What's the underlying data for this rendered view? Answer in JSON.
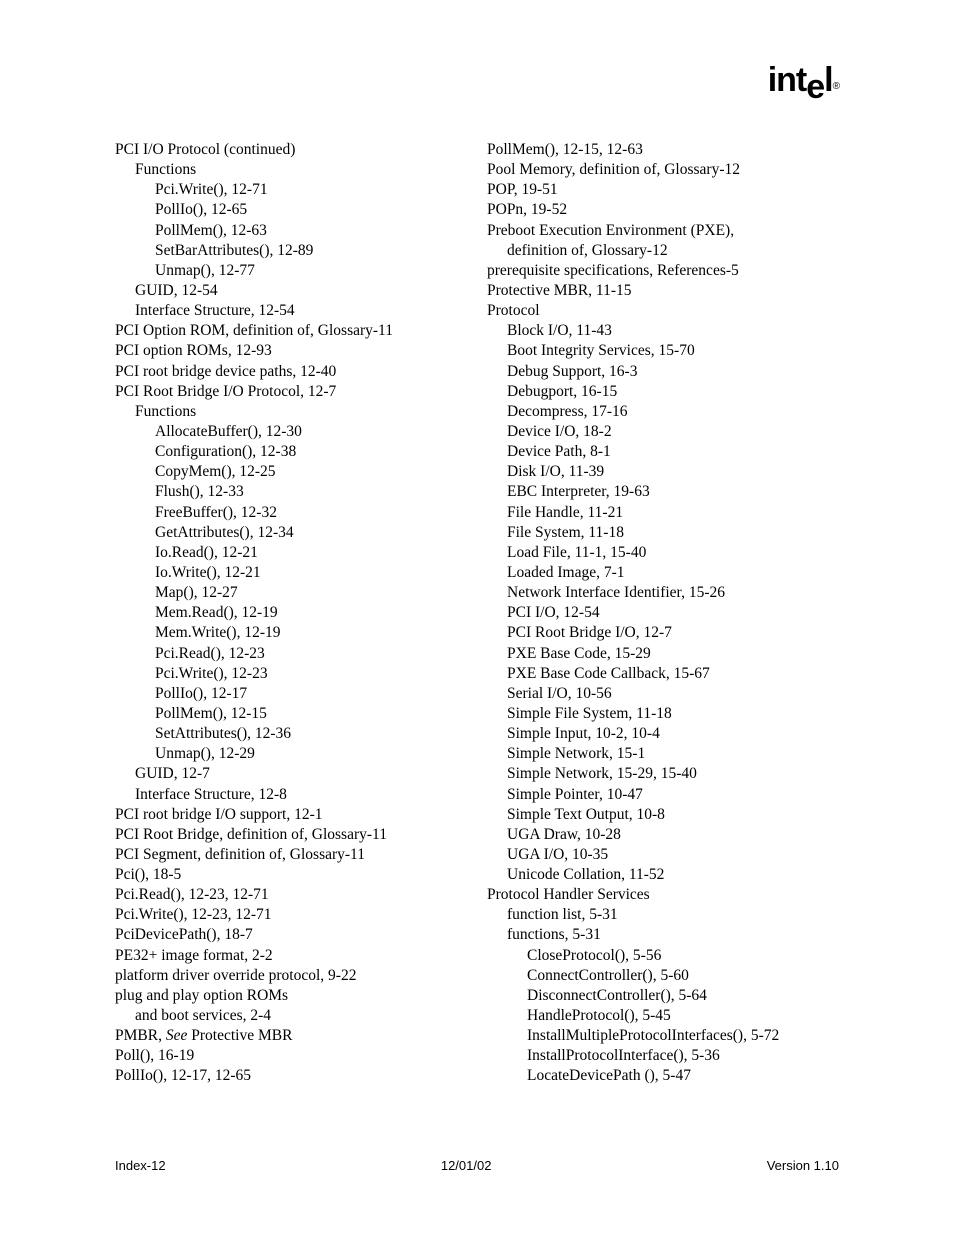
{
  "logo_text": "intel",
  "footer": {
    "left": "Index-12",
    "center": "12/01/02",
    "right": "Version 1.10"
  },
  "left_column": [
    {
      "text": "PCI I/O Protocol (continued)",
      "level": 0
    },
    {
      "text": "Functions",
      "level": 1
    },
    {
      "text": "Pci.Write(), 12-71",
      "level": 2
    },
    {
      "text": "PollIo(), 12-65",
      "level": 2
    },
    {
      "text": "PollMem(), 12-63",
      "level": 2
    },
    {
      "text": "SetBarAttributes(), 12-89",
      "level": 2
    },
    {
      "text": "Unmap(), 12-77",
      "level": 2
    },
    {
      "text": "GUID, 12-54",
      "level": 1
    },
    {
      "text": "Interface Structure, 12-54",
      "level": 1
    },
    {
      "text": "PCI Option ROM, definition of, Glossary-11",
      "level": 0
    },
    {
      "text": "PCI option ROMs, 12-93",
      "level": 0
    },
    {
      "text": "PCI root bridge device paths, 12-40",
      "level": 0
    },
    {
      "text": "PCI Root Bridge I/O Protocol, 12-7",
      "level": 0
    },
    {
      "text": "Functions",
      "level": 1
    },
    {
      "text": "AllocateBuffer(), 12-30",
      "level": 2
    },
    {
      "text": "Configuration(), 12-38",
      "level": 2
    },
    {
      "text": "CopyMem(), 12-25",
      "level": 2
    },
    {
      "text": "Flush(), 12-33",
      "level": 2
    },
    {
      "text": "FreeBuffer(), 12-32",
      "level": 2
    },
    {
      "text": "GetAttributes(), 12-34",
      "level": 2
    },
    {
      "text": "Io.Read(), 12-21",
      "level": 2
    },
    {
      "text": "Io.Write(), 12-21",
      "level": 2
    },
    {
      "text": "Map(), 12-27",
      "level": 2
    },
    {
      "text": "Mem.Read(), 12-19",
      "level": 2
    },
    {
      "text": "Mem.Write(), 12-19",
      "level": 2
    },
    {
      "text": "Pci.Read(), 12-23",
      "level": 2
    },
    {
      "text": "Pci.Write(), 12-23",
      "level": 2
    },
    {
      "text": "PollIo(), 12-17",
      "level": 2
    },
    {
      "text": "PollMem(), 12-15",
      "level": 2
    },
    {
      "text": "SetAttributes(), 12-36",
      "level": 2
    },
    {
      "text": "Unmap(), 12-29",
      "level": 2
    },
    {
      "text": "GUID, 12-7",
      "level": 1
    },
    {
      "text": "Interface Structure, 12-8",
      "level": 1
    },
    {
      "text": "PCI root bridge I/O support, 12-1",
      "level": 0
    },
    {
      "text": "PCI Root Bridge, definition of, Glossary-11",
      "level": 0
    },
    {
      "text": "PCI Segment, definition of, Glossary-11",
      "level": 0
    },
    {
      "text": "Pci(), 18-5",
      "level": 0
    },
    {
      "text": "Pci.Read(), 12-23, 12-71",
      "level": 0
    },
    {
      "text": "Pci.Write(), 12-23, 12-71",
      "level": 0
    },
    {
      "text": "PciDevicePath(), 18-7",
      "level": 0
    },
    {
      "text": "PE32+ image format, 2-2",
      "level": 0
    },
    {
      "text": "platform driver override protocol, 9-22",
      "level": 0
    },
    {
      "text": "plug and play option ROMs",
      "level": 0
    },
    {
      "text": "and boot services, 2-4",
      "level": 1
    },
    {
      "text": "PMBR, |See| Protective MBR",
      "level": 0,
      "hasItalic": true
    },
    {
      "text": "Poll(), 16-19",
      "level": 0
    },
    {
      "text": "PollIo(), 12-17, 12-65",
      "level": 0
    }
  ],
  "right_column": [
    {
      "text": "PollMem(), 12-15, 12-63",
      "level": 0
    },
    {
      "text": "Pool Memory, definition of, Glossary-12",
      "level": 0
    },
    {
      "text": "POP, 19-51",
      "level": 0
    },
    {
      "text": "POPn, 19-52",
      "level": 0
    },
    {
      "text": "Preboot Execution Environment (PXE),",
      "level": 0
    },
    {
      "text": "definition of, Glossary-12",
      "level": 1
    },
    {
      "text": "prerequisite specifications, References-5",
      "level": 0
    },
    {
      "text": "Protective MBR, 11-15",
      "level": 0
    },
    {
      "text": "Protocol",
      "level": 0
    },
    {
      "text": "Block I/O, 11-43",
      "level": 1
    },
    {
      "text": "Boot Integrity Services, 15-70",
      "level": 1
    },
    {
      "text": "Debug Support, 16-3",
      "level": 1
    },
    {
      "text": "Debugport, 16-15",
      "level": 1
    },
    {
      "text": "Decompress, 17-16",
      "level": 1
    },
    {
      "text": "Device I/O, 18-2",
      "level": 1
    },
    {
      "text": "Device Path, 8-1",
      "level": 1
    },
    {
      "text": "Disk I/O, 11-39",
      "level": 1
    },
    {
      "text": "EBC Interpreter, 19-63",
      "level": 1
    },
    {
      "text": "File Handle, 11-21",
      "level": 1
    },
    {
      "text": "File System, 11-18",
      "level": 1
    },
    {
      "text": "Load File, 11-1, 15-40",
      "level": 1
    },
    {
      "text": "Loaded Image, 7-1",
      "level": 1
    },
    {
      "text": "Network Interface Identifier, 15-26",
      "level": 1
    },
    {
      "text": "PCI I/O, 12-54",
      "level": 1
    },
    {
      "text": "PCI Root Bridge I/O, 12-7",
      "level": 1
    },
    {
      "text": "PXE Base Code, 15-29",
      "level": 1
    },
    {
      "text": "PXE Base Code Callback, 15-67",
      "level": 1
    },
    {
      "text": "Serial I/O, 10-56",
      "level": 1
    },
    {
      "text": "Simple File System, 11-18",
      "level": 1
    },
    {
      "text": "Simple Input, 10-2, 10-4",
      "level": 1
    },
    {
      "text": "Simple Network, 15-1",
      "level": 1
    },
    {
      "text": "Simple Network, 15-29, 15-40",
      "level": 1
    },
    {
      "text": "Simple Pointer, 10-47",
      "level": 1
    },
    {
      "text": "Simple Text Output, 10-8",
      "level": 1
    },
    {
      "text": "UGA Draw, 10-28",
      "level": 1
    },
    {
      "text": "UGA I/O, 10-35",
      "level": 1
    },
    {
      "text": "Unicode Collation, 11-52",
      "level": 1
    },
    {
      "text": "Protocol Handler Services",
      "level": 0
    },
    {
      "text": "function list, 5-31",
      "level": 1
    },
    {
      "text": "functions, 5-31",
      "level": 1
    },
    {
      "text": "CloseProtocol(), 5-56",
      "level": 2
    },
    {
      "text": "ConnectController(), 5-60",
      "level": 2
    },
    {
      "text": "DisconnectController(), 5-64",
      "level": 2
    },
    {
      "text": "HandleProtocol(), 5-45",
      "level": 2
    },
    {
      "text": "InstallMultipleProtocolInterfaces(), 5-72",
      "level": 2
    },
    {
      "text": "InstallProtocolInterface(), 5-36",
      "level": 2
    },
    {
      "text": "LocateDevicePath (), 5-47",
      "level": 2
    }
  ]
}
